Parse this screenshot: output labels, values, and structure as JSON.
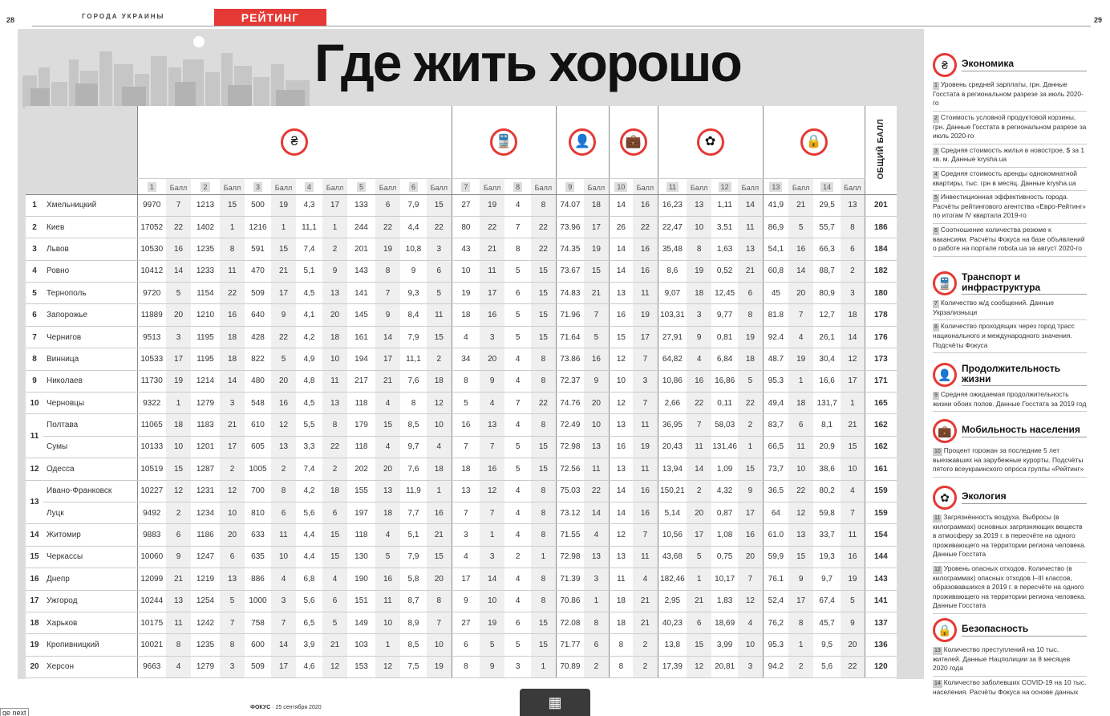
{
  "page_left_number": "28",
  "page_right_number": "29",
  "section_label": "ГОРОДА УКРАИНЫ",
  "rating_tag": "РЕЙТИНГ",
  "title": "Где жить хорошо",
  "total_label": "ОБЩИЙ БАЛЛ",
  "col_numbers": [
    "1",
    "2",
    "3",
    "4",
    "5",
    "6",
    "7",
    "8",
    "9",
    "10",
    "11",
    "12",
    "13",
    "14"
  ],
  "ball_label": "Балл",
  "groups": [
    {
      "name": "economy",
      "icon": "money-stack-icon",
      "glyph": "₴",
      "cols": 6
    },
    {
      "name": "transport",
      "icon": "train-icon",
      "glyph": "🚆",
      "cols": 2
    },
    {
      "name": "life",
      "icon": "person-icon",
      "glyph": "👤",
      "cols": 1
    },
    {
      "name": "mobility",
      "icon": "suitcase-icon",
      "glyph": "💼",
      "cols": 1
    },
    {
      "name": "ecology",
      "icon": "flower-icon",
      "glyph": "✿",
      "cols": 2
    },
    {
      "name": "safety",
      "icon": "lock-icon",
      "glyph": "🔒",
      "cols": 2
    }
  ],
  "rows": [
    {
      "rank": "1",
      "city": "Хмельницкий",
      "v": [
        "9970",
        "7",
        "1213",
        "15",
        "500",
        "19",
        "4,3",
        "17",
        "133",
        "6",
        "7,9",
        "15",
        "27",
        "19",
        "4",
        "8",
        "74.07",
        "18",
        "14",
        "16",
        "16,23",
        "13",
        "1,11",
        "14",
        "41,9",
        "21",
        "29,5",
        "13"
      ],
      "total": "201"
    },
    {
      "rank": "2",
      "city": "Киев",
      "v": [
        "17052",
        "22",
        "1402",
        "1",
        "1216",
        "1",
        "11,1",
        "1",
        "244",
        "22",
        "4,4",
        "22",
        "80",
        "22",
        "7",
        "22",
        "73.96",
        "17",
        "26",
        "22",
        "22,47",
        "10",
        "3,51",
        "11",
        "86,9",
        "5",
        "55,7",
        "8"
      ],
      "total": "186"
    },
    {
      "rank": "3",
      "city": "Львов",
      "v": [
        "10530",
        "16",
        "1235",
        "8",
        "591",
        "15",
        "7,4",
        "2",
        "201",
        "19",
        "10,8",
        "3",
        "43",
        "21",
        "8",
        "22",
        "74.35",
        "19",
        "14",
        "16",
        "35,48",
        "8",
        "1,63",
        "13",
        "54,1",
        "16",
        "66,3",
        "6"
      ],
      "total": "184"
    },
    {
      "rank": "4",
      "city": "Ровно",
      "v": [
        "10412",
        "14",
        "1233",
        "11",
        "470",
        "21",
        "5,1",
        "9",
        "143",
        "8",
        "9",
        "6",
        "10",
        "11",
        "5",
        "15",
        "73.67",
        "15",
        "14",
        "16",
        "8,6",
        "19",
        "0,52",
        "21",
        "60,8",
        "14",
        "88,7",
        "2"
      ],
      "total": "182"
    },
    {
      "rank": "5",
      "city": "Тернополь",
      "v": [
        "9720",
        "5",
        "1154",
        "22",
        "509",
        "17",
        "4,5",
        "13",
        "141",
        "7",
        "9,3",
        "5",
        "19",
        "17",
        "6",
        "15",
        "74.83",
        "21",
        "13",
        "11",
        "9,07",
        "18",
        "12,45",
        "6",
        "45",
        "20",
        "80,9",
        "3"
      ],
      "total": "180"
    },
    {
      "rank": "6",
      "city": "Запорожье",
      "v": [
        "11889",
        "20",
        "1210",
        "16",
        "640",
        "9",
        "4,1",
        "20",
        "145",
        "9",
        "8,4",
        "11",
        "18",
        "16",
        "5",
        "15",
        "71.96",
        "7",
        "16",
        "19",
        "103,31",
        "3",
        "9,77",
        "8",
        "81.8",
        "7",
        "12,7",
        "18"
      ],
      "total": "178"
    },
    {
      "rank": "7",
      "city": "Чернигов",
      "v": [
        "9513",
        "3",
        "1195",
        "18",
        "428",
        "22",
        "4,2",
        "18",
        "161",
        "14",
        "7,9",
        "15",
        "4",
        "3",
        "5",
        "15",
        "71.64",
        "5",
        "15",
        "17",
        "27,91",
        "9",
        "0,81",
        "19",
        "92.4",
        "4",
        "26,1",
        "14"
      ],
      "total": "176"
    },
    {
      "rank": "8",
      "city": "Винница",
      "v": [
        "10533",
        "17",
        "1195",
        "18",
        "822",
        "5",
        "4,9",
        "10",
        "194",
        "17",
        "11,1",
        "2",
        "34",
        "20",
        "4",
        "8",
        "73.86",
        "16",
        "12",
        "7",
        "64,82",
        "4",
        "6,84",
        "18",
        "48.7",
        "19",
        "30,4",
        "12"
      ],
      "total": "173"
    },
    {
      "rank": "9",
      "city": "Николаев",
      "v": [
        "11730",
        "19",
        "1214",
        "14",
        "480",
        "20",
        "4,8",
        "11",
        "217",
        "21",
        "7,6",
        "18",
        "8",
        "9",
        "4",
        "8",
        "72.37",
        "9",
        "10",
        "3",
        "10,86",
        "16",
        "16,86",
        "5",
        "95.3",
        "1",
        "16,6",
        "17"
      ],
      "total": "171"
    },
    {
      "rank": "10",
      "city": "Черновцы",
      "v": [
        "9322",
        "1",
        "1279",
        "3",
        "548",
        "16",
        "4,5",
        "13",
        "118",
        "4",
        "8",
        "12",
        "5",
        "4",
        "7",
        "22",
        "74.76",
        "20",
        "12",
        "7",
        "2,66",
        "22",
        "0,11",
        "22",
        "49,4",
        "18",
        "131,7",
        "1"
      ],
      "total": "165"
    },
    {
      "rank": "11",
      "city": "Полтава",
      "v": [
        "11065",
        "18",
        "1183",
        "21",
        "610",
        "12",
        "5,5",
        "8",
        "179",
        "15",
        "8,5",
        "10",
        "16",
        "13",
        "4",
        "8",
        "72.49",
        "10",
        "13",
        "11",
        "36,95",
        "7",
        "58,03",
        "2",
        "83,7",
        "6",
        "8,1",
        "21"
      ],
      "total": "162"
    },
    {
      "rank": "",
      "city": "Сумы",
      "v": [
        "10133",
        "10",
        "1201",
        "17",
        "605",
        "13",
        "3,3",
        "22",
        "118",
        "4",
        "9,7",
        "4",
        "7",
        "7",
        "5",
        "15",
        "72.98",
        "13",
        "16",
        "19",
        "20,43",
        "11",
        "131,46",
        "1",
        "66,5",
        "11",
        "20,9",
        "15"
      ],
      "total": "162"
    },
    {
      "rank": "12",
      "city": "Одесса",
      "v": [
        "10519",
        "15",
        "1287",
        "2",
        "1005",
        "2",
        "7,4",
        "2",
        "202",
        "20",
        "7,6",
        "18",
        "18",
        "16",
        "5",
        "15",
        "72.56",
        "11",
        "13",
        "11",
        "13,94",
        "14",
        "1,09",
        "15",
        "73,7",
        "10",
        "38,6",
        "10"
      ],
      "total": "161"
    },
    {
      "rank": "13",
      "city": "Ивано-Франковск",
      "v": [
        "10227",
        "12",
        "1231",
        "12",
        "700",
        "8",
        "4,2",
        "18",
        "155",
        "13",
        "11,9",
        "1",
        "13",
        "12",
        "4",
        "8",
        "75.03",
        "22",
        "14",
        "16",
        "150,21",
        "2",
        "4,32",
        "9",
        "36.5",
        "22",
        "80,2",
        "4"
      ],
      "total": "159"
    },
    {
      "rank": "",
      "city": "Луцк",
      "v": [
        "9492",
        "2",
        "1234",
        "10",
        "810",
        "6",
        "5,6",
        "6",
        "197",
        "18",
        "7,7",
        "16",
        "7",
        "7",
        "4",
        "8",
        "73.12",
        "14",
        "14",
        "16",
        "5,14",
        "20",
        "0,87",
        "17",
        "64",
        "12",
        "59,8",
        "7"
      ],
      "total": "159"
    },
    {
      "rank": "14",
      "city": "Житомир",
      "v": [
        "9883",
        "6",
        "1186",
        "20",
        "633",
        "11",
        "4,4",
        "15",
        "118",
        "4",
        "5,1",
        "21",
        "3",
        "1",
        "4",
        "8",
        "71.55",
        "4",
        "12",
        "7",
        "10,56",
        "17",
        "1,08",
        "16",
        "61.0",
        "13",
        "33,7",
        "11"
      ],
      "total": "154"
    },
    {
      "rank": "15",
      "city": "Черкассы",
      "v": [
        "10060",
        "9",
        "1247",
        "6",
        "635",
        "10",
        "4,4",
        "15",
        "130",
        "5",
        "7,9",
        "15",
        "4",
        "3",
        "2",
        "1",
        "72.98",
        "13",
        "13",
        "11",
        "43,68",
        "5",
        "0,75",
        "20",
        "59,9",
        "15",
        "19,3",
        "16"
      ],
      "total": "144"
    },
    {
      "rank": "16",
      "city": "Днепр",
      "v": [
        "12099",
        "21",
        "1219",
        "13",
        "886",
        "4",
        "6,8",
        "4",
        "190",
        "16",
        "5,8",
        "20",
        "17",
        "14",
        "4",
        "8",
        "71.39",
        "3",
        "11",
        "4",
        "182,46",
        "1",
        "10,17",
        "7",
        "76.1",
        "9",
        "9,7",
        "19"
      ],
      "total": "143"
    },
    {
      "rank": "17",
      "city": "Ужгород",
      "v": [
        "10244",
        "13",
        "1254",
        "5",
        "1000",
        "3",
        "5,6",
        "6",
        "151",
        "11",
        "8,7",
        "8",
        "9",
        "10",
        "4",
        "8",
        "70.86",
        "1",
        "18",
        "21",
        "2,95",
        "21",
        "1,83",
        "12",
        "52,4",
        "17",
        "67,4",
        "5"
      ],
      "total": "141"
    },
    {
      "rank": "18",
      "city": "Харьков",
      "v": [
        "10175",
        "11",
        "1242",
        "7",
        "758",
        "7",
        "6,5",
        "5",
        "149",
        "10",
        "8,9",
        "7",
        "27",
        "19",
        "6",
        "15",
        "72.08",
        "8",
        "18",
        "21",
        "40,23",
        "6",
        "18,69",
        "4",
        "76,2",
        "8",
        "45,7",
        "9"
      ],
      "total": "137"
    },
    {
      "rank": "19",
      "city": "Кропивницкий",
      "v": [
        "10021",
        "8",
        "1235",
        "8",
        "600",
        "14",
        "3,9",
        "21",
        "103",
        "1",
        "8,5",
        "10",
        "6",
        "5",
        "5",
        "15",
        "71.77",
        "6",
        "8",
        "2",
        "13,8",
        "15",
        "3,99",
        "10",
        "95.3",
        "1",
        "9,5",
        "20"
      ],
      "total": "136"
    },
    {
      "rank": "20",
      "city": "Херсон",
      "v": [
        "9663",
        "4",
        "1279",
        "3",
        "509",
        "17",
        "4,6",
        "12",
        "153",
        "12",
        "7,5",
        "19",
        "8",
        "9",
        "3",
        "1",
        "70.89",
        "2",
        "8",
        "2",
        "17,39",
        "12",
        "20,81",
        "3",
        "94.2",
        "2",
        "5,6",
        "22"
      ],
      "total": "120"
    }
  ],
  "legend": [
    {
      "key": "economy",
      "title": "Экономика",
      "icon": "money-stack-icon",
      "glyph": "₴",
      "items": [
        {
          "n": "1",
          "t": "Уровень средней зарплаты, грн. Данные Госстата в региональном разрезе за июль 2020-го"
        },
        {
          "n": "2",
          "t": "Стоимость условной продуктовой корзины, грн. Данные Госстата в региональном разрезе за июль 2020-го"
        },
        {
          "n": "3",
          "t": "Средняя стоимость жилья в новострое, $ за 1 кв. м. Данные krysha.ua"
        },
        {
          "n": "4",
          "t": "Средняя стоимость аренды однокомнатной квартиры, тыс. грн в месяц. Данные krysha.ua"
        },
        {
          "n": "5",
          "t": "Инвестиционная эффективность города. Расчёты рейтингового агентства «Евро-Рейтинг» по итогам IV квартала 2019-го"
        },
        {
          "n": "6",
          "t": "Соотношение количества резюме к вакансиям. Расчёты Фокуса на базе объявлений о работе на портале robota.ua за август 2020-го"
        }
      ]
    },
    {
      "key": "transport",
      "title": "Транспорт и инфраструктура",
      "icon": "train-icon",
      "glyph": "🚆",
      "items": [
        {
          "n": "7",
          "t": "Количество ж/д сообщений. Данные Укрзализныци"
        },
        {
          "n": "8",
          "t": "Количество проходящих через город трасс национального и международного значения. Подсчёты Фокуса"
        }
      ]
    },
    {
      "key": "life",
      "title": "Продолжительность жизни",
      "icon": "person-icon",
      "glyph": "👤",
      "items": [
        {
          "n": "9",
          "t": "Средняя ожидаемая продолжительность жизни обоих полов. Данные Госстата за 2019 год"
        }
      ]
    },
    {
      "key": "mobility",
      "title": "Мобильность населения",
      "icon": "suitcase-icon",
      "glyph": "💼",
      "items": [
        {
          "n": "10",
          "t": "Процент горожан за последние 5 лет выезжавших на зарубежные курорты. Подсчёты пятого всеукраинского опроса группы «Рейтинг»"
        }
      ]
    },
    {
      "key": "ecology",
      "title": "Экология",
      "icon": "flower-icon",
      "glyph": "✿",
      "items": [
        {
          "n": "11",
          "t": "Загрязнённость воздуха. Выбросы (в килограммах) основных загрязняющих веществ в атмосферу за 2019 г. в пересчёте на одного проживающего на территории региона человека. Данные Госстата"
        },
        {
          "n": "12",
          "t": "Уровень опасных отходов. Количество (в килограммах) опасных отходов I–III классов, образовавшихся в 2019 г. в пересчёте на одного проживающего на территории региона человека. Данные Госстата"
        }
      ]
    },
    {
      "key": "safety",
      "title": "Безопасность",
      "icon": "lock-icon",
      "glyph": "🔒",
      "items": [
        {
          "n": "13",
          "t": "Количество преступлений на 10 тыс. жителей. Данные Нацполиции за 8 месяцев 2020 года"
        },
        {
          "n": "14",
          "t": "Количество заболевших COVID-19 на 10 тыс. населения. Расчёты Фокуса на основе данных СНБО"
        }
      ]
    }
  ],
  "footer_brand": "ФОКУС",
  "footer_date": "· 25 сентября 2020",
  "corner_text": "ge next"
}
